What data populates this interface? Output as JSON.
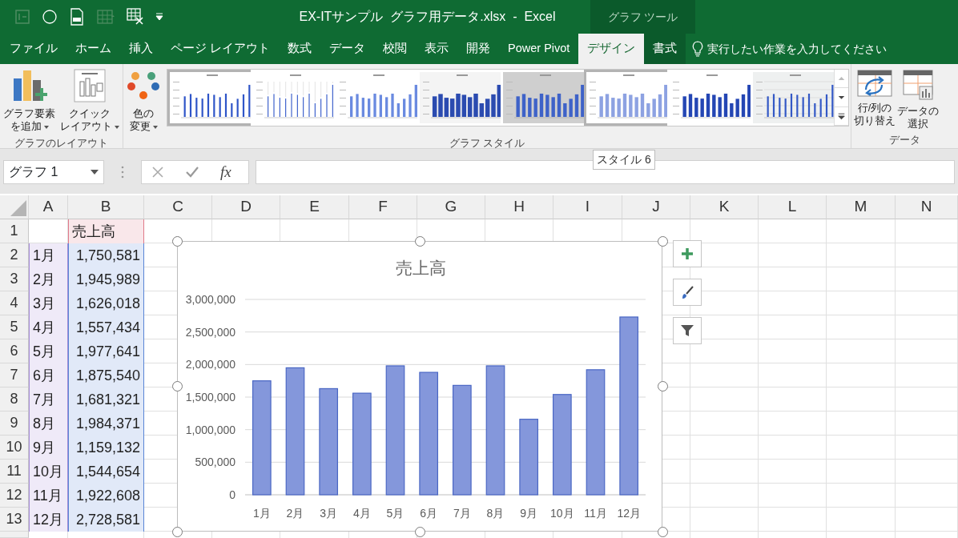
{
  "window": {
    "title": "EX-ITサンプル  グラフ用データ.xlsx  -  Excel",
    "context_tab": "グラフ ツール"
  },
  "ribbon_tabs": [
    {
      "label": "ファイル",
      "selected": false,
      "contextual": false
    },
    {
      "label": "ホーム",
      "selected": false,
      "contextual": false
    },
    {
      "label": "挿入",
      "selected": false,
      "contextual": false
    },
    {
      "label": "ページ レイアウト",
      "selected": false,
      "contextual": false
    },
    {
      "label": "数式",
      "selected": false,
      "contextual": false
    },
    {
      "label": "データ",
      "selected": false,
      "contextual": false
    },
    {
      "label": "校閲",
      "selected": false,
      "contextual": false
    },
    {
      "label": "表示",
      "selected": false,
      "contextual": false
    },
    {
      "label": "開発",
      "selected": false,
      "contextual": false
    },
    {
      "label": "Power Pivot",
      "selected": false,
      "contextual": false
    },
    {
      "label": "デザイン",
      "selected": true,
      "contextual": true
    },
    {
      "label": "書式",
      "selected": false,
      "contextual": true
    }
  ],
  "tell_me": {
    "placeholder": "実行したい作業を入力してください"
  },
  "ribbon": {
    "groups": [
      {
        "label": "グラフのレイアウト",
        "buttons": [
          {
            "lines": [
              "グラフ要素",
              "を追加"
            ],
            "dropdown": true,
            "kind": "add_element"
          },
          {
            "lines": [
              "クイック",
              "レイアウト"
            ],
            "dropdown": true,
            "kind": "quick_layout"
          }
        ]
      },
      {
        "label": "グラフ スタイル",
        "buttons": [
          {
            "lines": [
              "色の",
              "変更"
            ],
            "dropdown": true,
            "kind": "colors"
          }
        ],
        "gallery": [
          {
            "kind": "bars",
            "selected": true
          },
          {
            "kind": "labels",
            "selected": false
          },
          {
            "kind": "light",
            "selected": false
          },
          {
            "kind": "dark3d",
            "selected": false
          },
          {
            "kind": "grey",
            "selected": false
          },
          {
            "kind": "pale",
            "selected": true
          },
          {
            "kind": "solid",
            "selected": false
          },
          {
            "kind": "hatched",
            "selected": false
          }
        ]
      },
      {
        "label": "データ",
        "buttons": [
          {
            "lines": [
              "行/列の",
              "切り替え"
            ],
            "dropdown": false,
            "kind": "switch"
          },
          {
            "lines": [
              "データの",
              "選択"
            ],
            "dropdown": false,
            "kind": "select_data"
          }
        ]
      }
    ]
  },
  "tooltip": "スタイル 6",
  "formula_bar": {
    "name_box": "グラフ 1",
    "function_label": "fx"
  },
  "sheet": {
    "columns": [
      "A",
      "B",
      "C",
      "D",
      "E",
      "F",
      "G",
      "H",
      "I",
      "J",
      "K",
      "L",
      "M",
      "N"
    ],
    "rows": [
      {
        "header": "1",
        "b": {
          "text": "売上高",
          "color": "#e07a8a"
        }
      },
      {
        "header": "2",
        "a": {
          "text": "1月",
          "color": "#a58bd6"
        },
        "b": {
          "text": "1,750,581",
          "color": "#5a86d6"
        }
      },
      {
        "header": "3",
        "a": {
          "text": "2月",
          "color": "#a58bd6"
        },
        "b": {
          "text": "1,945,989",
          "color": "#5a86d6"
        }
      },
      {
        "header": "4",
        "a": {
          "text": "3月",
          "color": "#a58bd6"
        },
        "b": {
          "text": "1,626,018",
          "color": "#5a86d6"
        }
      },
      {
        "header": "5",
        "a": {
          "text": "4月",
          "color": "#a58bd6"
        },
        "b": {
          "text": "1,557,434",
          "color": "#5a86d6"
        }
      },
      {
        "header": "6",
        "a": {
          "text": "5月",
          "color": "#a58bd6"
        },
        "b": {
          "text": "1,977,641",
          "color": "#5a86d6"
        }
      },
      {
        "header": "7",
        "a": {
          "text": "6月",
          "color": "#a58bd6"
        },
        "b": {
          "text": "1,875,540",
          "color": "#5a86d6"
        }
      },
      {
        "header": "8",
        "a": {
          "text": "7月",
          "color": "#a58bd6"
        },
        "b": {
          "text": "1,681,321",
          "color": "#5a86d6"
        }
      },
      {
        "header": "9",
        "a": {
          "text": "8月",
          "color": "#a58bd6"
        },
        "b": {
          "text": "1,984,371",
          "color": "#5a86d6"
        }
      },
      {
        "header": "10",
        "a": {
          "text": "9月",
          "color": "#a58bd6"
        },
        "b": {
          "text": "1,159,132",
          "color": "#5a86d6"
        }
      },
      {
        "header": "11",
        "a": {
          "text": "10月",
          "color": "#a58bd6"
        },
        "b": {
          "text": "1,544,654",
          "color": "#5a86d6"
        }
      },
      {
        "header": "12",
        "a": {
          "text": "11月",
          "color": "#a58bd6"
        },
        "b": {
          "text": "1,922,608",
          "color": "#5a86d6"
        }
      },
      {
        "header": "13",
        "a": {
          "text": "12月",
          "color": "#a58bd6"
        },
        "b": {
          "text": "2,728,581",
          "color": "#5a86d6"
        }
      }
    ]
  },
  "chart": {
    "selected": true,
    "chart_data": {
      "type": "bar",
      "title": "売上高",
      "categories": [
        "1月",
        "2月",
        "3月",
        "4月",
        "5月",
        "6月",
        "7月",
        "8月",
        "9月",
        "10月",
        "11月",
        "12月"
      ],
      "series": [
        {
          "color": "#8497db",
          "values": [
            1750000,
            1950000,
            1630000,
            1560000,
            1980000,
            1880000,
            1680000,
            1980000,
            1160000,
            1540000,
            1920000,
            2730000
          ]
        }
      ],
      "ylim": [
        0,
        3000000
      ],
      "grid": true,
      "yticks": [
        {
          "value": 0,
          "label": "0"
        },
        {
          "value": 500000,
          "label": "500,000"
        },
        {
          "value": 1000000,
          "label": "1,000,000"
        },
        {
          "value": 1500000,
          "label": "1,500,000"
        },
        {
          "value": 2000000,
          "label": "2,000,000"
        },
        {
          "value": 2500000,
          "label": "2,500,000"
        },
        {
          "value": 3000000,
          "label": "3,000,000"
        }
      ]
    }
  }
}
